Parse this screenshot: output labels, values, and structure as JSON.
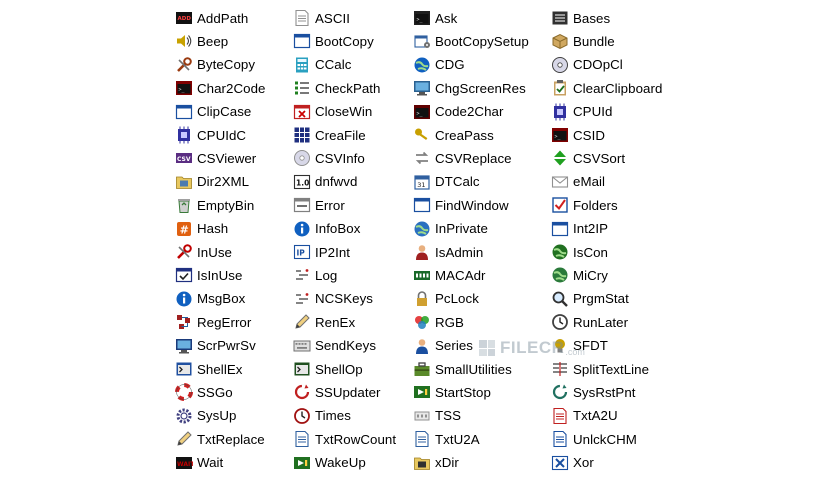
{
  "columns": [
    {
      "items": [
        {
          "label": "AddPath",
          "icon": "add-path-icon",
          "color": "#c00000"
        },
        {
          "label": "Beep",
          "icon": "speaker-icon",
          "color": "#c8a200"
        },
        {
          "label": "ByteCopy",
          "icon": "tools-icon",
          "color": "#9a3b10"
        },
        {
          "label": "Char2Code",
          "icon": "terminal-icon",
          "color": "#800000"
        },
        {
          "label": "ClipCase",
          "icon": "window-icon",
          "color": "#1a4fa0"
        },
        {
          "label": "CPUIdC",
          "icon": "chip-icon",
          "color": "#3030a0"
        },
        {
          "label": "CSViewer",
          "icon": "csv-icon",
          "color": "#5a2d82"
        },
        {
          "label": "Dir2XML",
          "icon": "folder-image-icon",
          "color": "#4a7ab0"
        },
        {
          "label": "EmptyBin",
          "icon": "recycle-bin-icon",
          "color": "#3a7a3a"
        },
        {
          "label": "Hash",
          "icon": "hash-icon",
          "color": "#e06010"
        },
        {
          "label": "InUse",
          "icon": "wrench-icon",
          "color": "#c00000"
        },
        {
          "label": "IsInUse",
          "icon": "window-check-icon",
          "color": "#203080"
        },
        {
          "label": "MsgBox",
          "icon": "info-bubble-icon",
          "color": "#1060c0"
        },
        {
          "label": "RegError",
          "icon": "registry-icon",
          "color": "#a02020"
        },
        {
          "label": "ScrPwrSv",
          "icon": "monitor-icon",
          "color": "#1a3a7a"
        },
        {
          "label": "ShellEx",
          "icon": "shell-icon",
          "color": "#2050a0"
        },
        {
          "label": "SSGo",
          "icon": "lifebuoy-icon",
          "color": "#d02020"
        },
        {
          "label": "SysUp",
          "icon": "gear-icon",
          "color": "#404080"
        },
        {
          "label": "TxtReplace",
          "icon": "pencil-icon",
          "color": "#707070"
        },
        {
          "label": "Wait",
          "icon": "wait-icon",
          "color": "#c00000"
        }
      ]
    },
    {
      "items": [
        {
          "label": "ASCII",
          "icon": "document-icon",
          "color": "#909090"
        },
        {
          "label": "BootCopy",
          "icon": "window-icon",
          "color": "#1a4fa0"
        },
        {
          "label": "CCalc",
          "icon": "calculator-icon",
          "color": "#2aa0c0"
        },
        {
          "label": "CheckPath",
          "icon": "checklist-icon",
          "color": "#303030"
        },
        {
          "label": "CloseWin",
          "icon": "close-window-icon",
          "color": "#c02020"
        },
        {
          "label": "CreaFile",
          "icon": "grid-icon",
          "color": "#203080"
        },
        {
          "label": "CSVInfo",
          "icon": "cd-icon",
          "color": "#909090"
        },
        {
          "label": "dnfwvd",
          "icon": "version-icon",
          "color": "#303030"
        },
        {
          "label": "Error",
          "icon": "error-window-icon",
          "color": "#808080"
        },
        {
          "label": "InfoBox",
          "icon": "info-icon",
          "color": "#1060c0"
        },
        {
          "label": "IP2Int",
          "icon": "ip-icon",
          "color": "#303030"
        },
        {
          "label": "Log",
          "icon": "log-icon",
          "color": "#505050"
        },
        {
          "label": "NCSKeys",
          "icon": "keys-icon",
          "color": "#505050"
        },
        {
          "label": "RenEx",
          "icon": "rename-icon",
          "color": "#707070"
        },
        {
          "label": "SendKeys",
          "icon": "keyboard-icon",
          "color": "#707070"
        },
        {
          "label": "ShellOp",
          "icon": "shell-grid-icon",
          "color": "#205020"
        },
        {
          "label": "SSUpdater",
          "icon": "update-icon",
          "color": "#c02020"
        },
        {
          "label": "Times",
          "icon": "clock-icon",
          "color": "#a01010"
        },
        {
          "label": "TxtRowCount",
          "icon": "text-doc-icon",
          "color": "#3060a0"
        },
        {
          "label": "WakeUp",
          "icon": "wake-icon",
          "color": "#207020"
        }
      ]
    },
    {
      "items": [
        {
          "label": "Ask",
          "icon": "console-icon",
          "color": "#202020"
        },
        {
          "label": "BootCopySetup",
          "icon": "setup-icon",
          "color": "#3060a0"
        },
        {
          "label": "CDG",
          "icon": "globe-icon",
          "color": "#1060c0"
        },
        {
          "label": "ChgScreenRes",
          "icon": "monitor-icon",
          "color": "#2a6090"
        },
        {
          "label": "Code2Char",
          "icon": "terminal-icon",
          "color": "#600000"
        },
        {
          "label": "CreaPass",
          "icon": "key-icon",
          "color": "#c8a000"
        },
        {
          "label": "CSVReplace",
          "icon": "replace-icon",
          "color": "#808080"
        },
        {
          "label": "DTCalc",
          "icon": "calendar-icon",
          "color": "#3060a0"
        },
        {
          "label": "FindWindow",
          "icon": "find-window-icon",
          "color": "#1a4fa0"
        },
        {
          "label": "InPrivate",
          "icon": "globe-icon",
          "color": "#2a70c0"
        },
        {
          "label": "IsAdmin",
          "icon": "admin-icon",
          "color": "#a02020"
        },
        {
          "label": "MACAdr",
          "icon": "network-icon",
          "color": "#1a6a2a"
        },
        {
          "label": "PcLock",
          "icon": "lock-icon",
          "color": "#707070"
        },
        {
          "label": "RGB",
          "icon": "palette-icon",
          "color": "#2080c0"
        },
        {
          "label": "Series",
          "icon": "user-icon",
          "color": "#1a4fa0"
        },
        {
          "label": "SmallUtilities",
          "icon": "toolbox-icon",
          "color": "#5a8a2a"
        },
        {
          "label": "StartStop",
          "icon": "start-stop-icon",
          "color": "#207020"
        },
        {
          "label": "TSS",
          "icon": "tss-icon",
          "color": "#909090"
        },
        {
          "label": "TxtU2A",
          "icon": "text-doc-icon",
          "color": "#3060a0"
        },
        {
          "label": "xDir",
          "icon": "search-folder-icon",
          "color": "#303030"
        }
      ]
    },
    {
      "items": [
        {
          "label": "Bases",
          "icon": "bases-icon",
          "color": "#303030"
        },
        {
          "label": "Bundle",
          "icon": "bundle-icon",
          "color": "#8a6a2a"
        },
        {
          "label": "CDOpCl",
          "icon": "disc-icon",
          "color": "#404040"
        },
        {
          "label": "ClearClipboard",
          "icon": "clipboard-icon",
          "color": "#207020"
        },
        {
          "label": "CPUId",
          "icon": "chip-icon",
          "color": "#3030a0"
        },
        {
          "label": "CSID",
          "icon": "terminal-icon",
          "color": "#800000"
        },
        {
          "label": "CSVSort",
          "icon": "sort-icon",
          "color": "#20a020"
        },
        {
          "label": "eMail",
          "icon": "mail-icon",
          "color": "#909090"
        },
        {
          "label": "Folders",
          "icon": "checkbox-icon",
          "color": "#1a4fa0"
        },
        {
          "label": "Int2IP",
          "icon": "ip-window-icon",
          "color": "#1a4fa0"
        },
        {
          "label": "IsCon",
          "icon": "globe-net-icon",
          "color": "#207020"
        },
        {
          "label": "MiCry",
          "icon": "globe-icon",
          "color": "#2a7a3a"
        },
        {
          "label": "PrgmStat",
          "icon": "magnifier-icon",
          "color": "#303030"
        },
        {
          "label": "RunLater",
          "icon": "timer-icon",
          "color": "#404040"
        },
        {
          "label": "SFDT",
          "icon": "bulb-icon",
          "color": "#c8a000"
        },
        {
          "label": "SplitTextLine",
          "icon": "split-icon",
          "color": "#505050"
        },
        {
          "label": "SysRstPnt",
          "icon": "restore-icon",
          "color": "#207060"
        },
        {
          "label": "TxtA2U",
          "icon": "text-doc-icon",
          "color": "#c02020"
        },
        {
          "label": "UnlckCHM",
          "icon": "help-doc-icon",
          "color": "#1a4fa0"
        },
        {
          "label": "Xor",
          "icon": "xor-icon",
          "color": "#1a4fa0"
        }
      ]
    }
  ],
  "watermark": {
    "text": "FILECR",
    "suffix": ".com",
    "icon": "filecr-logo-icon"
  }
}
